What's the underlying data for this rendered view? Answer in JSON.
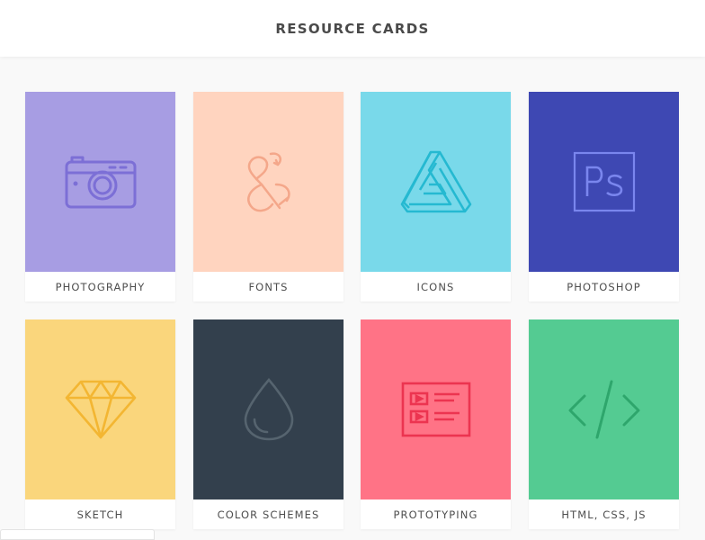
{
  "header": {
    "title": "RESOURCE CARDS"
  },
  "cards": [
    {
      "label": "PHOTOGRAPHY",
      "icon": "camera-icon",
      "bg": "#a79de3",
      "icon_color": "#7c6fd6"
    },
    {
      "label": "FONTS",
      "icon": "ampersand-icon",
      "bg": "#ffd4bf",
      "icon_color": "#f4a78a"
    },
    {
      "label": "ICONS",
      "icon": "penrose-triangle-icon",
      "bg": "#79d9ea",
      "icon_color": "#25b9d1"
    },
    {
      "label": "PHOTOSHOP",
      "icon": "photoshop-icon",
      "bg": "#3e48b3",
      "icon_color": "#7a86ee"
    },
    {
      "label": "SKETCH",
      "icon": "diamond-icon",
      "bg": "#fad67c",
      "icon_color": "#f3b632"
    },
    {
      "label": "COLOR SCHEMES",
      "icon": "droplet-icon",
      "bg": "#33404d",
      "icon_color": "#56646f"
    },
    {
      "label": "PROTOTYPING",
      "icon": "wireframe-icon",
      "bg": "#ff7386",
      "icon_color": "#ec3450"
    },
    {
      "label": "HTML, CSS, JS",
      "icon": "code-icon",
      "bg": "#54cb92",
      "icon_color": "#2ea66c"
    }
  ]
}
